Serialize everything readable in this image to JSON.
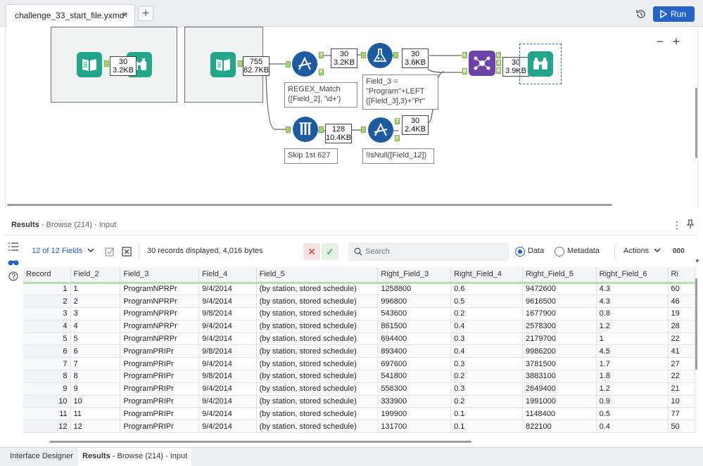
{
  "app": {
    "file_tab": "challenge_33_start_file.yxmd*",
    "close_glyph": "×",
    "add_glyph": "+",
    "run_label": "Run"
  },
  "canvas": {
    "zoom_out": "−",
    "zoom_in": "+",
    "container1_count": [
      "30",
      "3.2KB"
    ],
    "input_count": [
      "755",
      "82.7KB"
    ],
    "filter_true_count": [
      "30",
      "3.2KB"
    ],
    "formula_count": [
      "30",
      "3.6KB"
    ],
    "join_count": [
      "30",
      "3.9KB"
    ],
    "sample_count": [
      "128",
      "10.4KB"
    ],
    "filter2_true_count": [
      "30",
      "2.4KB"
    ],
    "annotations": {
      "filter1": [
        "REGEX_Match",
        "([Field_2], '\\d+')"
      ],
      "formula": [
        "Field_3 =",
        "\"Program\"+LEFT",
        "([Field_3],3)+\"Pr\""
      ],
      "sample": [
        "Skip 1st 627"
      ],
      "filter2": [
        "!IsNull([Field_12])"
      ]
    },
    "anchor_labels": {
      "true": "T",
      "false": "F",
      "left": "L",
      "join": "J",
      "right": "R"
    },
    "colors": {
      "io_green": "#22a68b",
      "filter_blue": "#1e5aa0",
      "join_purple": "#6d42a8",
      "anchor_green": "#a6d176"
    }
  },
  "results": {
    "title": "Results",
    "subtitle": " - Browse (214) - Input",
    "kebab": "⋮",
    "fields_dropdown": "12 of 12 Fields",
    "record_info": "30 records displayed, 4,016 bytes",
    "search_placeholder": "Search",
    "radio_data": "Data",
    "radio_metadata": "Metadata",
    "actions": "Actions",
    "overflow": "000",
    "clear_glyph": "✕",
    "apply_glyph": "✓",
    "columns": [
      "Record",
      "Field_2",
      "Field_3",
      "Field_4",
      "Field_5",
      "Right_Field_3",
      "Right_Field_4",
      "Right_Field_5",
      "Right_Field_6",
      "Ri"
    ],
    "rows": [
      [
        "1",
        "1",
        "ProgramNPRPr",
        "9/4/2014",
        "(by station, stored schedule)",
        "1258800",
        "0.6",
        "9472600",
        "4.3",
        "60"
      ],
      [
        "2",
        "2",
        "ProgramNPRPr",
        "9/4/2014",
        "(by station, stored schedule)",
        "996800",
        "0.5",
        "9616500",
        "4.3",
        "46"
      ],
      [
        "3",
        "3",
        "ProgramNPRPr",
        "9/8/2014",
        "(by station, stored schedule)",
        "543600",
        "0.2",
        "1677900",
        "0.8",
        "19"
      ],
      [
        "4",
        "4",
        "ProgramNPRPr",
        "9/4/2014",
        "(by station, stored schedule)",
        "861500",
        "0.4",
        "2578300",
        "1.2",
        "28"
      ],
      [
        "5",
        "5",
        "ProgramNPRPr",
        "9/4/2014",
        "(by station, stored schedule)",
        "694400",
        "0.3",
        "2179700",
        "1",
        "22"
      ],
      [
        "6",
        "6",
        "ProgramPRIPr",
        "9/8/2014",
        "(by station, stored schedule)",
        "893400",
        "0.4",
        "9986200",
        "4.5",
        "41"
      ],
      [
        "7",
        "7",
        "ProgramPRIPr",
        "9/4/2014",
        "(by station, stored schedule)",
        "697600",
        "0.3",
        "3781500",
        "1.7",
        "27"
      ],
      [
        "8",
        "8",
        "ProgramPRIPr",
        "9/8/2014",
        "(by station, stored schedule)",
        "541800",
        "0.2",
        "3883100",
        "1.8",
        "22"
      ],
      [
        "9",
        "9",
        "ProgramPRIPr",
        "9/4/2014",
        "(by station, stored schedule)",
        "556300",
        "0.3",
        "2649400",
        "1.2",
        "21"
      ],
      [
        "10",
        "10",
        "ProgramPRIPr",
        "9/4/2014",
        "(by station, stored schedule)",
        "333900",
        "0.2",
        "1991000",
        "0.9",
        "10"
      ],
      [
        "11",
        "11",
        "ProgramPRIPr",
        "9/4/2014",
        "(by station, stored schedule)",
        "199900",
        "0.1",
        "1148400",
        "0.5",
        "77"
      ],
      [
        "12",
        "12",
        "ProgramPRIPr",
        "9/4/2014",
        "(by station, stored schedule)",
        "131700",
        "0.1",
        "822100",
        "0.4",
        "50"
      ]
    ]
  },
  "bottom_tabs": {
    "interface_designer": "Interface Designer",
    "results_bold": "Results",
    "results_rest": " - Browse (214) - Input"
  }
}
